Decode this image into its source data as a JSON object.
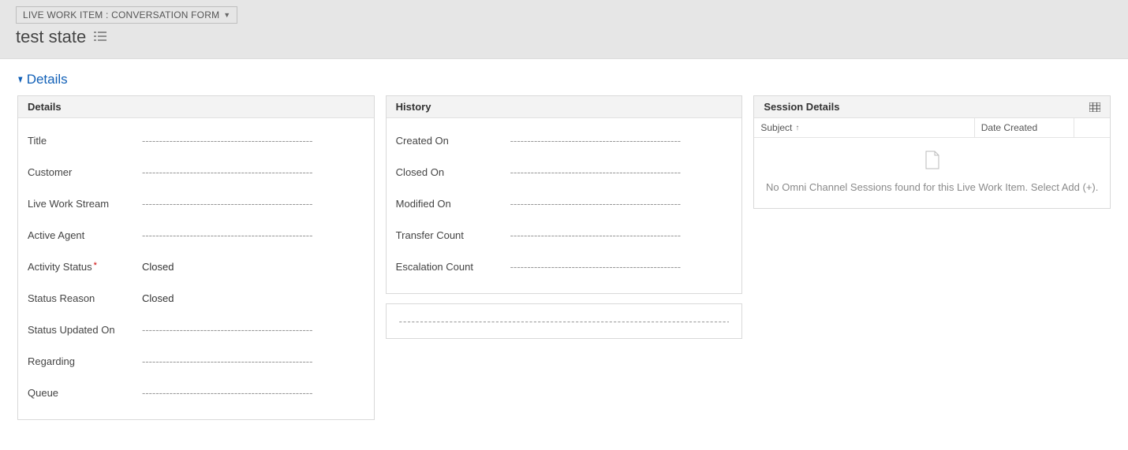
{
  "header": {
    "form_type_label": "LIVE WORK ITEM : CONVERSATION FORM",
    "record_title": "test state"
  },
  "section": {
    "title": "Details"
  },
  "details_panel": {
    "title": "Details",
    "fields": {
      "title": {
        "label": "Title",
        "value": ""
      },
      "customer": {
        "label": "Customer",
        "value": ""
      },
      "live_work_stream": {
        "label": "Live Work Stream",
        "value": ""
      },
      "active_agent": {
        "label": "Active Agent",
        "value": ""
      },
      "activity_status": {
        "label": "Activity Status",
        "value": "Closed",
        "required": true
      },
      "status_reason": {
        "label": "Status Reason",
        "value": "Closed"
      },
      "status_updated_on": {
        "label": "Status Updated On",
        "value": ""
      },
      "regarding": {
        "label": "Regarding",
        "value": ""
      },
      "queue": {
        "label": "Queue",
        "value": ""
      }
    }
  },
  "history_panel": {
    "title": "History",
    "fields": {
      "created_on": {
        "label": "Created On",
        "value": ""
      },
      "closed_on": {
        "label": "Closed On",
        "value": ""
      },
      "modified_on": {
        "label": "Modified On",
        "value": ""
      },
      "transfer_count": {
        "label": "Transfer Count",
        "value": ""
      },
      "escalation_count": {
        "label": "Escalation Count",
        "value": ""
      }
    }
  },
  "session_panel": {
    "title": "Session Details",
    "columns": {
      "subject": "Subject",
      "date_created": "Date Created"
    },
    "empty_message": "No Omni Channel Sessions found for this Live Work Item. Select Add (+)."
  },
  "dash": "--------------------------------------------------"
}
